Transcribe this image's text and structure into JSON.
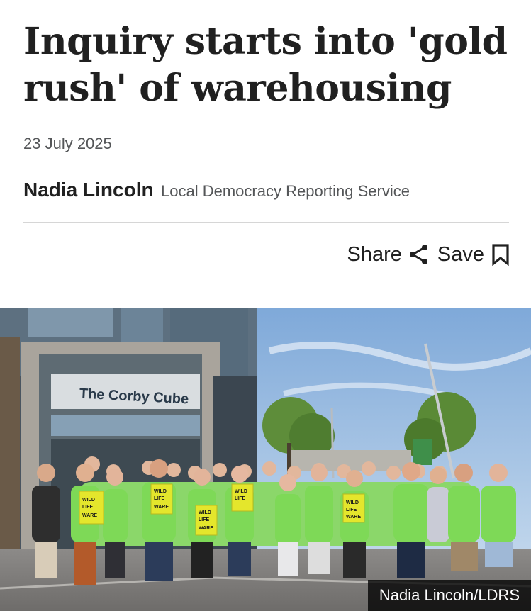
{
  "article": {
    "headline": "Inquiry starts into 'gold rush' of warehousing",
    "date": "23 July 2025",
    "author": "Nadia Lincoln",
    "organisation": "Local Democracy Reporting Service"
  },
  "actions": {
    "share_label": "Share",
    "save_label": "Save",
    "share_icon": "share-icon",
    "save_icon": "bookmark-icon"
  },
  "photo": {
    "building_sign": "The Corby Cube",
    "placard_text": "WILD LIFE not WARE HOUSES",
    "credit": "Nadia Lincoln/LDRS"
  },
  "colors": {
    "text": "#202020",
    "muted": "#545658",
    "tshirt_green": "#7ed957",
    "placard_yellow": "#e4e62c",
    "sky": "#9fc2e6"
  }
}
